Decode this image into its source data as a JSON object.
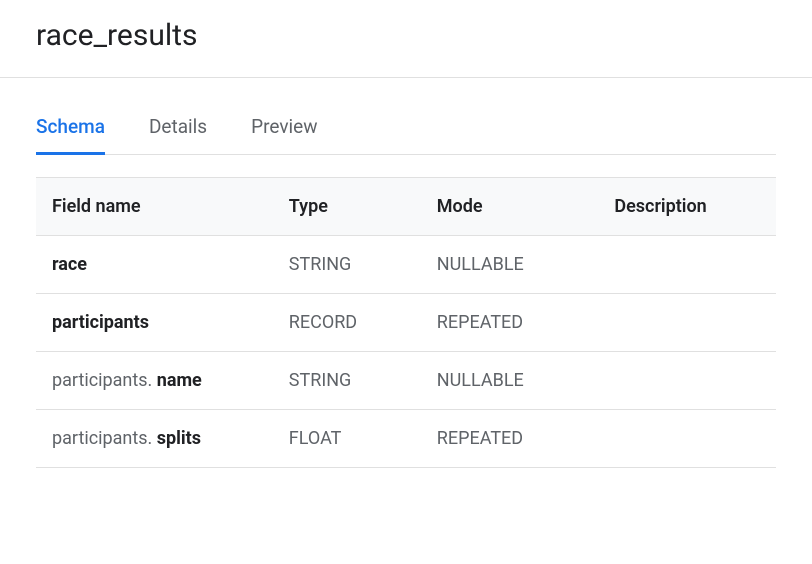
{
  "title": "race_results",
  "tabs": [
    {
      "label": "Schema",
      "active": true
    },
    {
      "label": "Details",
      "active": false
    },
    {
      "label": "Preview",
      "active": false
    }
  ],
  "schema": {
    "headers": {
      "field_name": "Field name",
      "type": "Type",
      "mode": "Mode",
      "description": "Description"
    },
    "rows": [
      {
        "prefix": "",
        "name": "race",
        "type": "STRING",
        "mode": "NULLABLE",
        "description": ""
      },
      {
        "prefix": "",
        "name": "participants",
        "type": "RECORD",
        "mode": "REPEATED",
        "description": ""
      },
      {
        "prefix": "participants. ",
        "name": "name",
        "type": "STRING",
        "mode": "NULLABLE",
        "description": ""
      },
      {
        "prefix": "participants. ",
        "name": "splits",
        "type": "FLOAT",
        "mode": "REPEATED",
        "description": ""
      }
    ]
  }
}
